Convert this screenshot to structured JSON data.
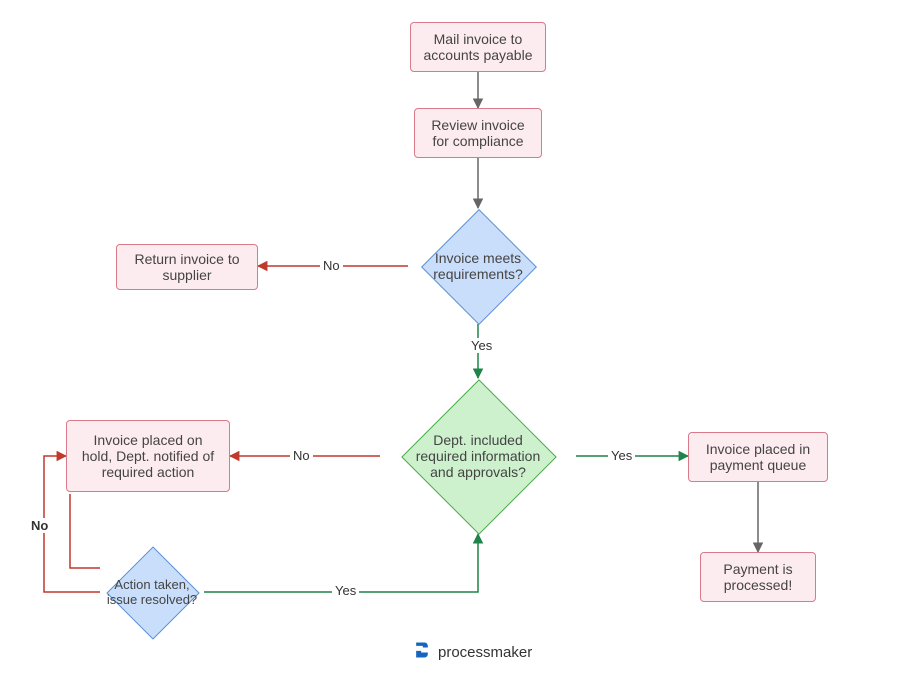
{
  "nodes": {
    "mail": "Mail invoice to accounts payable",
    "review": "Review invoice for compliance",
    "meets": "Invoice meets requirements?",
    "return": "Return invoice to supplier",
    "dept": "Dept. included required information and approvals?",
    "hold": "Invoice placed on hold, Dept. notified of required action",
    "action": "Action taken, issue resolved?",
    "queue": "Invoice placed in payment queue",
    "processed": "Payment is processed!"
  },
  "edges": {
    "no1": "No",
    "yes1": "Yes",
    "no2": "No",
    "yes2": "Yes",
    "no3": "No",
    "yes3": "Yes"
  },
  "logo": "processmaker"
}
